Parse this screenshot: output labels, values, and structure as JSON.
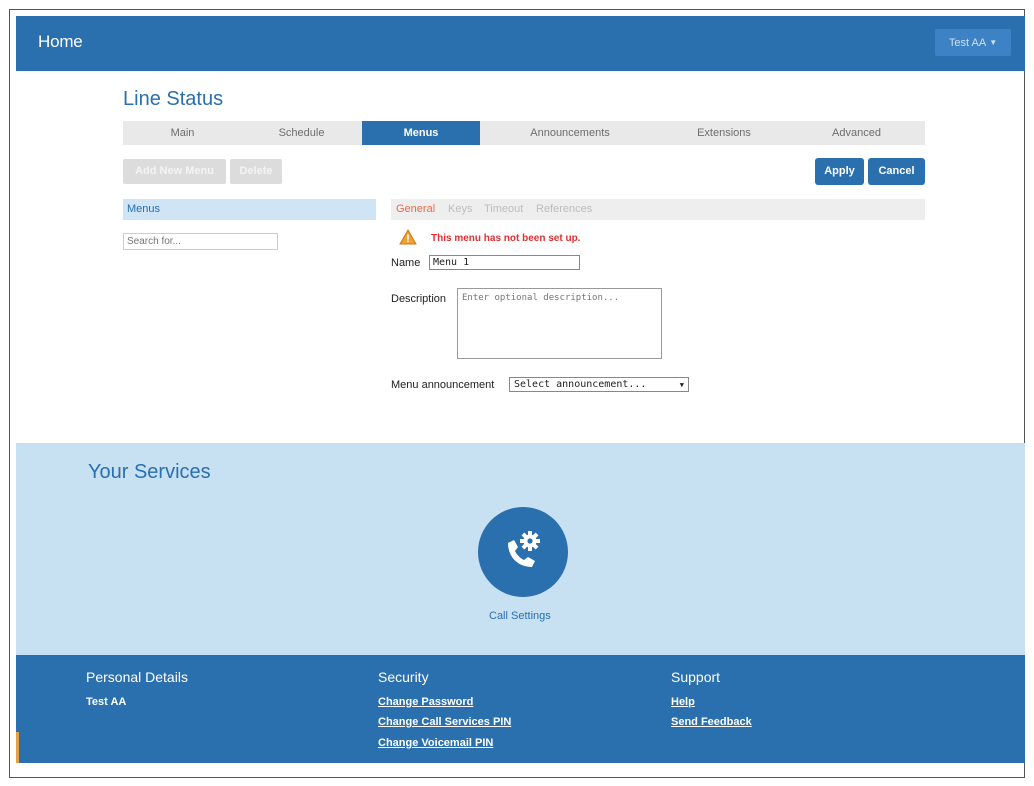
{
  "header": {
    "title": "Home",
    "user_menu": "Test AA"
  },
  "line_status": {
    "title": "Line Status",
    "tabs": [
      {
        "label": "Main",
        "active": false
      },
      {
        "label": "Schedule",
        "active": false
      },
      {
        "label": "Menus",
        "active": true
      },
      {
        "label": "Announcements",
        "active": false
      },
      {
        "label": "Extensions",
        "active": false
      },
      {
        "label": "Advanced",
        "active": false
      }
    ],
    "toolbar": {
      "add_new_menu": "Add New Menu",
      "delete": "Delete",
      "apply": "Apply",
      "cancel": "Cancel"
    },
    "menus_panel": {
      "title": "Menus",
      "search_placeholder": "Search for..."
    },
    "subtabs": [
      {
        "label": "General",
        "active": true
      },
      {
        "label": "Keys",
        "active": false
      },
      {
        "label": "Timeout",
        "active": false
      },
      {
        "label": "References",
        "active": false
      }
    ],
    "warning": "This menu has not been set up.",
    "form": {
      "name_label": "Name",
      "name_value": "Menu 1",
      "description_label": "Description",
      "description_placeholder": "Enter optional description...",
      "announcement_label": "Menu announcement",
      "announcement_value": "Select announcement..."
    }
  },
  "services": {
    "title": "Your Services",
    "call_settings_label": "Call Settings"
  },
  "footer": {
    "personal": {
      "heading": "Personal Details",
      "name": "Test AA"
    },
    "security": {
      "heading": "Security",
      "links": [
        "Change Password",
        "Change Call Services PIN",
        "Change Voicemail PIN"
      ]
    },
    "support": {
      "heading": "Support",
      "links": [
        "Help",
        "Send Feedback"
      ]
    }
  },
  "colors": {
    "brand": "#2a6fae",
    "services_bg": "#c7e1f2",
    "warning": "#e03030",
    "active_subtab": "#f06a4a"
  },
  "icons": {
    "user_menu": "chevron-down-icon",
    "warning": "warning-triangle-icon",
    "call_settings": "phone-gear-icon",
    "select": "caret-down-icon"
  }
}
